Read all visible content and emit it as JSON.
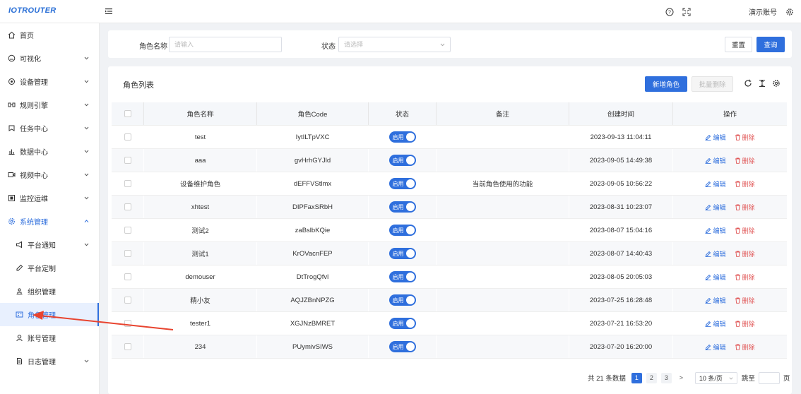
{
  "brand": {
    "logo_text": "IOTROUTER"
  },
  "header": {
    "account_label": "演示账号"
  },
  "sidebar": {
    "items": [
      {
        "label": "首页"
      },
      {
        "label": "可视化"
      },
      {
        "label": "设备管理"
      },
      {
        "label": "规则引擎"
      },
      {
        "label": "任务中心"
      },
      {
        "label": "数据中心"
      },
      {
        "label": "视频中心"
      },
      {
        "label": "监控运维"
      },
      {
        "label": "系统管理"
      }
    ],
    "sub_items": [
      {
        "label": "平台通知"
      },
      {
        "label": "平台定制"
      },
      {
        "label": "组织管理"
      },
      {
        "label": "角色管理"
      },
      {
        "label": "账号管理"
      },
      {
        "label": "日志管理"
      }
    ]
  },
  "search": {
    "name_label": "角色名称",
    "name_placeholder": "请输入",
    "status_label": "状态",
    "status_placeholder": "请选择",
    "reset_label": "重置",
    "query_label": "查询"
  },
  "list": {
    "title": "角色列表",
    "add_label": "新增角色",
    "batch_delete_label": "批量删除"
  },
  "table": {
    "columns": [
      "角色名称",
      "角色Code",
      "状态",
      "备注",
      "创建时间",
      "操作"
    ],
    "status_text": "启用",
    "edit_label": "编辑",
    "delete_label": "删除",
    "rows": [
      {
        "name": "test",
        "code": "IytILTpVXC",
        "note": "",
        "created": "2023-09-13 11:04:11"
      },
      {
        "name": "aaa",
        "code": "gvHrhGYJld",
        "note": "",
        "created": "2023-09-05 14:49:38"
      },
      {
        "name": "设备维护角色",
        "code": "dEFFVStlmx",
        "note": "当前角色使用的功能",
        "created": "2023-09-05 10:56:22"
      },
      {
        "name": "xhtest",
        "code": "DIPFaxSRbH",
        "note": "",
        "created": "2023-08-31 10:23:07"
      },
      {
        "name": "测试2",
        "code": "zaBslbKQie",
        "note": "",
        "created": "2023-08-07 15:04:16"
      },
      {
        "name": "测试1",
        "code": "KrOVacnFEP",
        "note": "",
        "created": "2023-08-07 14:40:43"
      },
      {
        "name": "demouser",
        "code": "DtTrogQfvl",
        "note": "",
        "created": "2023-08-05 20:05:03"
      },
      {
        "name": "精小友",
        "code": "AQJZBnNPZG",
        "note": "",
        "created": "2023-07-25 16:28:48"
      },
      {
        "name": "tester1",
        "code": "XGJNzBMRET",
        "note": "",
        "created": "2023-07-21 16:53:20"
      },
      {
        "name": "234",
        "code": "PUymivSIWS",
        "note": "",
        "created": "2023-07-20 16:20:00"
      }
    ]
  },
  "pagination": {
    "total_text": "共 21 条数据",
    "pages": [
      "1",
      "2",
      "3"
    ],
    "current_page": "1",
    "next_symbol": ">",
    "page_size": "10 条/页",
    "jump_label": "跳至",
    "page_unit": "页"
  },
  "colors": {
    "primary": "#2f6fdd",
    "danger": "#e05555",
    "annotation_arrow": "#e8442f"
  }
}
